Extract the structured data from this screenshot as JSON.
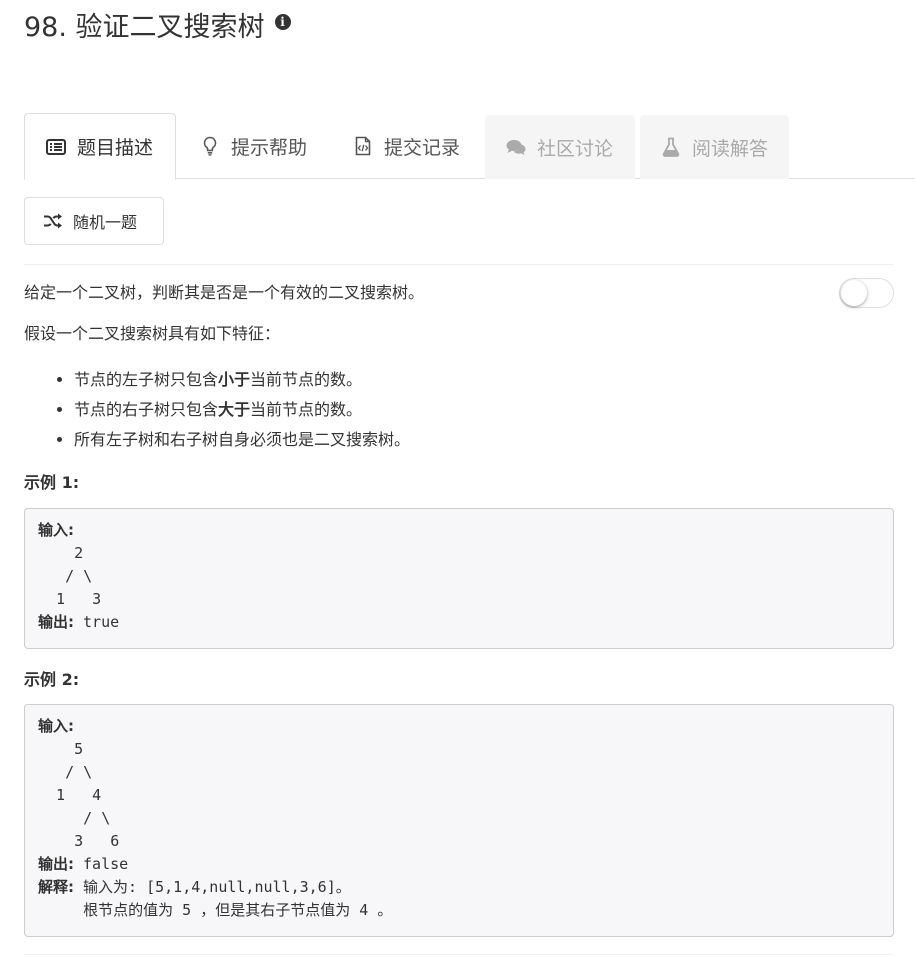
{
  "problem": {
    "title": "98. 验证二叉搜索树"
  },
  "tabs": [
    {
      "label": "题目描述",
      "icon": "list-alt-icon",
      "state": "active"
    },
    {
      "label": "提示帮助",
      "icon": "lightbulb-icon",
      "state": "normal"
    },
    {
      "label": "提交记录",
      "icon": "file-code-icon",
      "state": "normal"
    },
    {
      "label": "社区讨论",
      "icon": "comments-icon",
      "state": "disabled"
    },
    {
      "label": "阅读解答",
      "icon": "flask-icon",
      "state": "disabled"
    }
  ],
  "random_button": {
    "label": "随机一题",
    "icon": "shuffle-icon"
  },
  "toggle": {
    "state": "off"
  },
  "description": {
    "intro": "给定一个二叉树，判断其是否是一个有效的二叉搜索树。",
    "assume": "假设一个二叉搜索树具有如下特征：",
    "features": [
      {
        "pre": "节点的左子树只包含",
        "bold": "小于",
        "post": "当前节点的数。"
      },
      {
        "pre": "节点的右子树只包含",
        "bold": "大于",
        "post": "当前节点的数。"
      },
      {
        "pre": "所有左子树和右子树自身必须也是二叉搜索树。",
        "bold": "",
        "post": ""
      }
    ]
  },
  "examples": [
    {
      "title": "示例 1:",
      "input_label": "输入:",
      "tree": "    2\n   / \\\n  1   3",
      "output_label": "输出:",
      "output": " true"
    },
    {
      "title": "示例 2:",
      "input_label": "输入:",
      "tree": "    5\n   / \\\n  1   4\n     / \\\n    3   6",
      "output_label": "输出:",
      "output": " false",
      "explain_label": "解释:",
      "explain": " 输入为: [5,1,4,null,null,3,6]。\n     根节点的值为 5 ，但是其右子节点值为 4 。"
    }
  ],
  "colors": {
    "text": "#333333",
    "disabled_text": "#aaaaaa",
    "disabled_tab_bg": "#f5f5f5",
    "code_bg": "#f7f7f9",
    "border": "#dddddd"
  }
}
